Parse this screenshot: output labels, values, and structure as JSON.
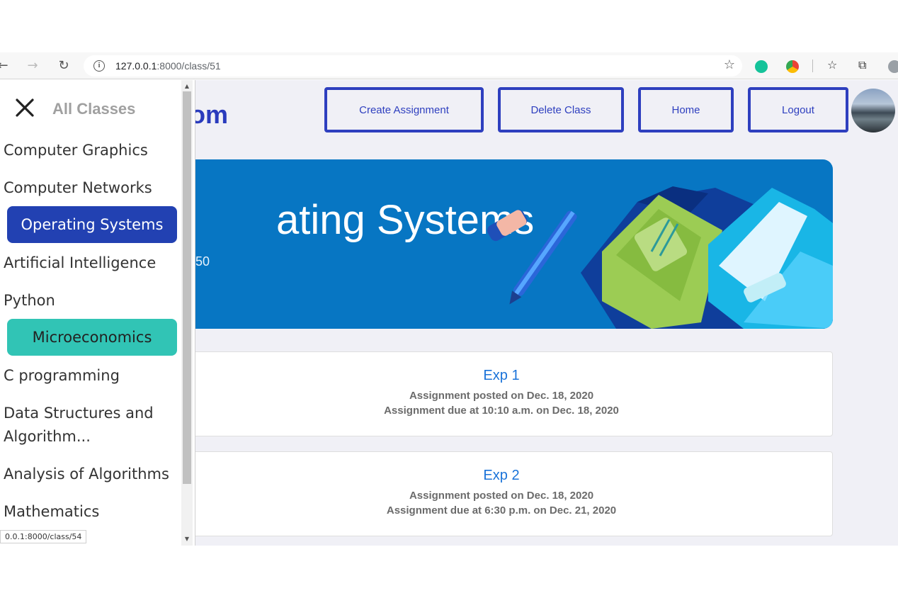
{
  "browser": {
    "url_host": "127.0.0.1",
    "url_rest": ":8000/class/51"
  },
  "header": {
    "brand_fragment": "om",
    "buttons": [
      "Create Assignment",
      "Delete Class",
      "Home",
      "Logout"
    ]
  },
  "banner": {
    "title_fragment": "ating Systems",
    "subtitle_fragment": "50"
  },
  "assignments": [
    {
      "title": "Exp 1",
      "posted": "Assignment posted on Dec. 18, 2020",
      "due": "Assignment due at 10:10 a.m. on Dec. 18, 2020"
    },
    {
      "title": "Exp 2",
      "posted": "Assignment posted on Dec. 18, 2020",
      "due": "Assignment due at 6:30 p.m. on Dec. 21, 2020"
    }
  ],
  "sidebar": {
    "title": "All Classes",
    "items": [
      "Computer Graphics",
      "Computer Networks",
      "Operating Systems",
      "Artificial Intelligence",
      "Python",
      "Microeconomics",
      "C programming",
      "Data Structures and Algorithm...",
      "Analysis of Algorithms",
      "Mathematics"
    ]
  },
  "status_bar": {
    "link_preview": "0.0.1:8000/class/54"
  },
  "colors": {
    "primary": "#2e3fbf",
    "active_item": "#2241b2",
    "teal_item": "#31c4b5",
    "banner": "#0776c3",
    "assignment_link": "#1a73d9"
  }
}
